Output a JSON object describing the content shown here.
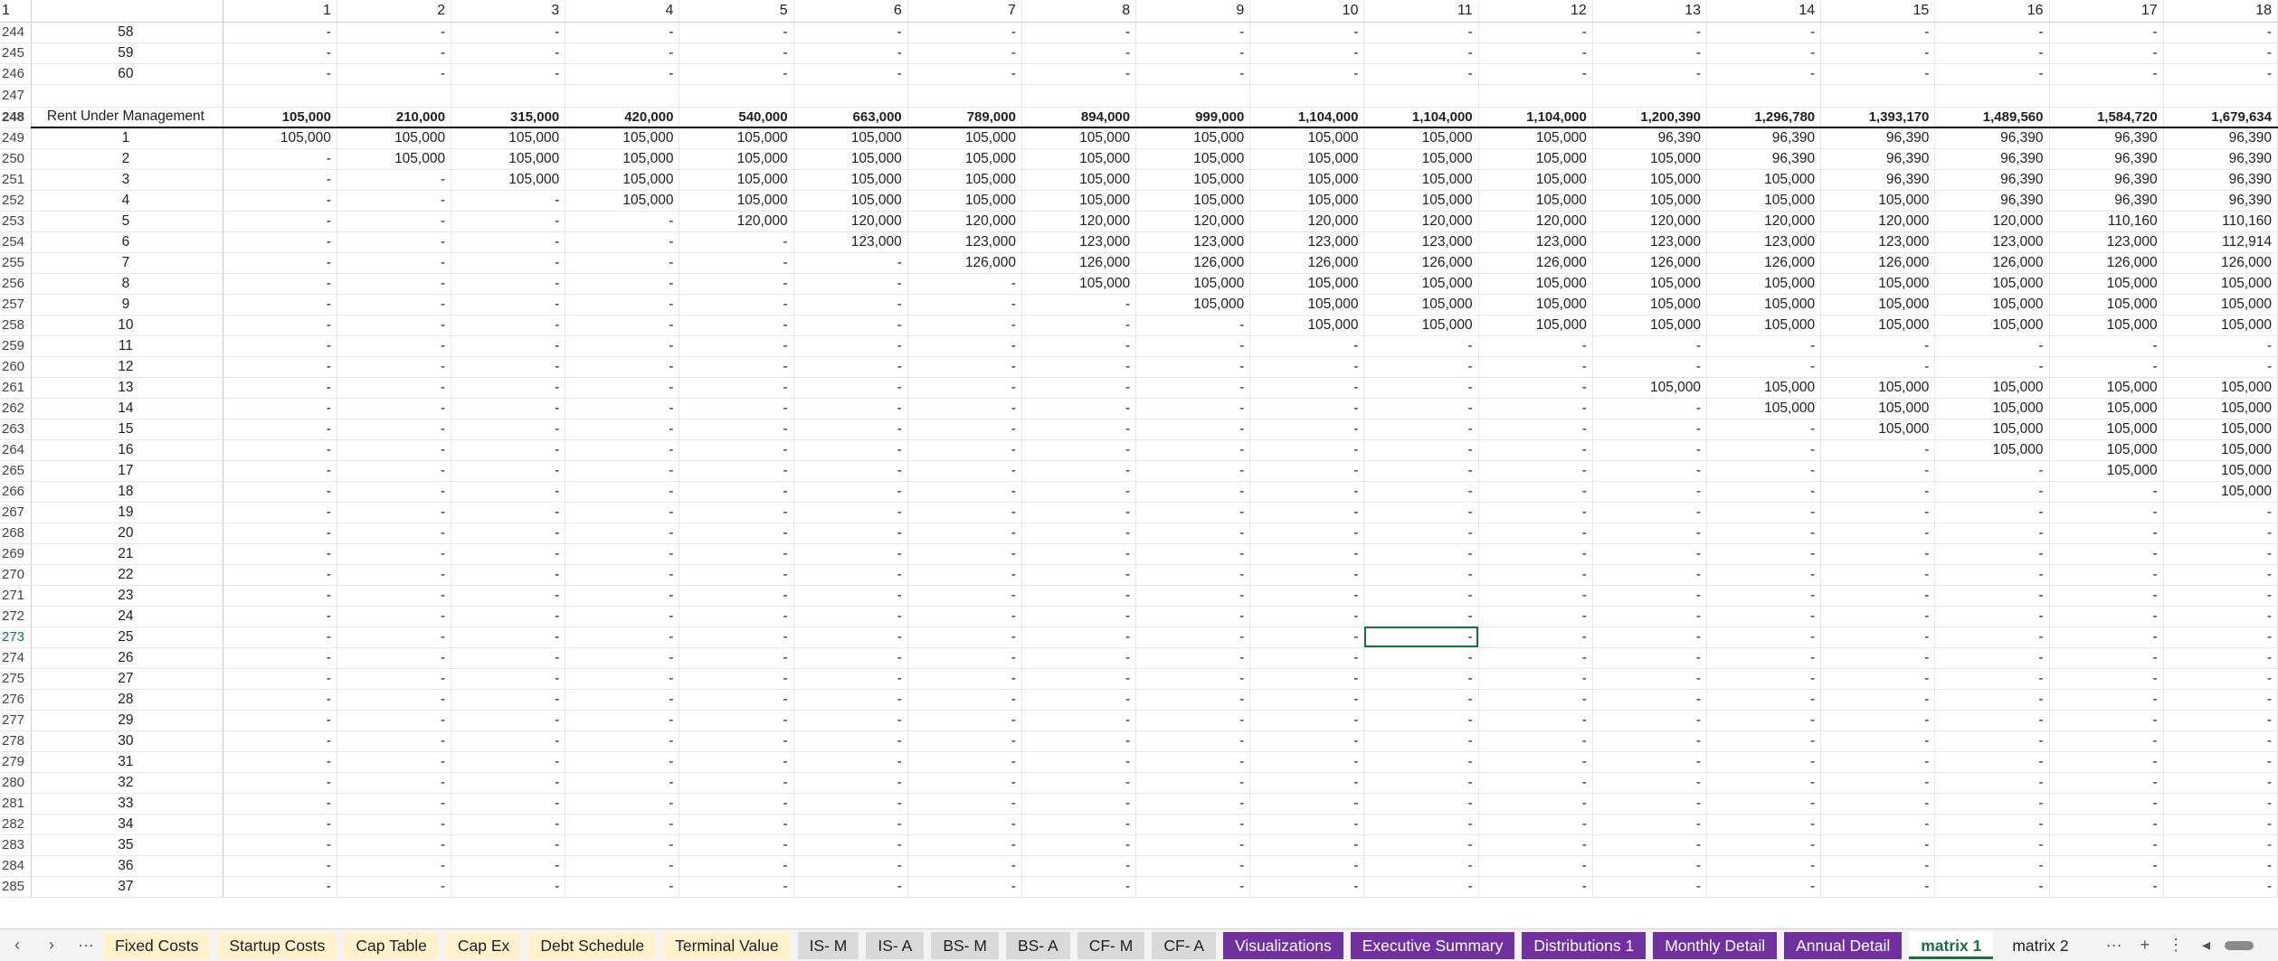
{
  "column_numbers": [
    "1",
    "2",
    "3",
    "4",
    "5",
    "6",
    "7",
    "8",
    "9",
    "10",
    "11",
    "12",
    "13",
    "14",
    "15",
    "16",
    "17",
    "18"
  ],
  "header_row_number": "1",
  "rows": [
    {
      "row": "244",
      "label": "58",
      "values": [
        "-",
        "-",
        "-",
        "-",
        "-",
        "-",
        "-",
        "-",
        "-",
        "-",
        "-",
        "-",
        "-",
        "-",
        "-",
        "-",
        "-",
        "-"
      ]
    },
    {
      "row": "245",
      "label": "59",
      "values": [
        "-",
        "-",
        "-",
        "-",
        "-",
        "-",
        "-",
        "-",
        "-",
        "-",
        "-",
        "-",
        "-",
        "-",
        "-",
        "-",
        "-",
        "-"
      ]
    },
    {
      "row": "246",
      "label": "60",
      "values": [
        "-",
        "-",
        "-",
        "-",
        "-",
        "-",
        "-",
        "-",
        "-",
        "-",
        "-",
        "-",
        "-",
        "-",
        "-",
        "-",
        "-",
        "-"
      ]
    },
    {
      "row": "247",
      "label": "",
      "values": [
        "",
        "",
        "",
        "",
        "",
        "",
        "",
        "",
        "",
        "",
        "",
        "",
        "",
        "",
        "",
        "",
        "",
        ""
      ],
      "gap": true
    },
    {
      "row": "248",
      "label": "Rent Under Management",
      "values": [
        "105,000",
        "210,000",
        "315,000",
        "420,000",
        "540,000",
        "663,000",
        "789,000",
        "894,000",
        "999,000",
        "1,104,000",
        "1,104,000",
        "1,104,000",
        "1,200,390",
        "1,296,780",
        "1,393,170",
        "1,489,560",
        "1,584,720",
        "1,679,634"
      ],
      "summary": true
    },
    {
      "row": "249",
      "label": "1",
      "values": [
        "105,000",
        "105,000",
        "105,000",
        "105,000",
        "105,000",
        "105,000",
        "105,000",
        "105,000",
        "105,000",
        "105,000",
        "105,000",
        "105,000",
        "96,390",
        "96,390",
        "96,390",
        "96,390",
        "96,390",
        "96,390"
      ]
    },
    {
      "row": "250",
      "label": "2",
      "values": [
        "-",
        "105,000",
        "105,000",
        "105,000",
        "105,000",
        "105,000",
        "105,000",
        "105,000",
        "105,000",
        "105,000",
        "105,000",
        "105,000",
        "105,000",
        "96,390",
        "96,390",
        "96,390",
        "96,390",
        "96,390"
      ]
    },
    {
      "row": "251",
      "label": "3",
      "values": [
        "-",
        "-",
        "105,000",
        "105,000",
        "105,000",
        "105,000",
        "105,000",
        "105,000",
        "105,000",
        "105,000",
        "105,000",
        "105,000",
        "105,000",
        "105,000",
        "96,390",
        "96,390",
        "96,390",
        "96,390"
      ]
    },
    {
      "row": "252",
      "label": "4",
      "values": [
        "-",
        "-",
        "-",
        "105,000",
        "105,000",
        "105,000",
        "105,000",
        "105,000",
        "105,000",
        "105,000",
        "105,000",
        "105,000",
        "105,000",
        "105,000",
        "105,000",
        "96,390",
        "96,390",
        "96,390"
      ]
    },
    {
      "row": "253",
      "label": "5",
      "values": [
        "-",
        "-",
        "-",
        "-",
        "120,000",
        "120,000",
        "120,000",
        "120,000",
        "120,000",
        "120,000",
        "120,000",
        "120,000",
        "120,000",
        "120,000",
        "120,000",
        "120,000",
        "110,160",
        "110,160"
      ]
    },
    {
      "row": "254",
      "label": "6",
      "values": [
        "-",
        "-",
        "-",
        "-",
        "-",
        "123,000",
        "123,000",
        "123,000",
        "123,000",
        "123,000",
        "123,000",
        "123,000",
        "123,000",
        "123,000",
        "123,000",
        "123,000",
        "123,000",
        "112,914"
      ]
    },
    {
      "row": "255",
      "label": "7",
      "values": [
        "-",
        "-",
        "-",
        "-",
        "-",
        "-",
        "126,000",
        "126,000",
        "126,000",
        "126,000",
        "126,000",
        "126,000",
        "126,000",
        "126,000",
        "126,000",
        "126,000",
        "126,000",
        "126,000"
      ]
    },
    {
      "row": "256",
      "label": "8",
      "values": [
        "-",
        "-",
        "-",
        "-",
        "-",
        "-",
        "-",
        "105,000",
        "105,000",
        "105,000",
        "105,000",
        "105,000",
        "105,000",
        "105,000",
        "105,000",
        "105,000",
        "105,000",
        "105,000"
      ]
    },
    {
      "row": "257",
      "label": "9",
      "values": [
        "-",
        "-",
        "-",
        "-",
        "-",
        "-",
        "-",
        "-",
        "105,000",
        "105,000",
        "105,000",
        "105,000",
        "105,000",
        "105,000",
        "105,000",
        "105,000",
        "105,000",
        "105,000"
      ]
    },
    {
      "row": "258",
      "label": "10",
      "values": [
        "-",
        "-",
        "-",
        "-",
        "-",
        "-",
        "-",
        "-",
        "-",
        "105,000",
        "105,000",
        "105,000",
        "105,000",
        "105,000",
        "105,000",
        "105,000",
        "105,000",
        "105,000"
      ]
    },
    {
      "row": "259",
      "label": "11",
      "values": [
        "-",
        "-",
        "-",
        "-",
        "-",
        "-",
        "-",
        "-",
        "-",
        "-",
        "-",
        "-",
        "-",
        "-",
        "-",
        "-",
        "-",
        "-"
      ]
    },
    {
      "row": "260",
      "label": "12",
      "values": [
        "-",
        "-",
        "-",
        "-",
        "-",
        "-",
        "-",
        "-",
        "-",
        "-",
        "-",
        "-",
        "-",
        "-",
        "-",
        "-",
        "-",
        "-"
      ]
    },
    {
      "row": "261",
      "label": "13",
      "values": [
        "-",
        "-",
        "-",
        "-",
        "-",
        "-",
        "-",
        "-",
        "-",
        "-",
        "-",
        "-",
        "105,000",
        "105,000",
        "105,000",
        "105,000",
        "105,000",
        "105,000"
      ]
    },
    {
      "row": "262",
      "label": "14",
      "values": [
        "-",
        "-",
        "-",
        "-",
        "-",
        "-",
        "-",
        "-",
        "-",
        "-",
        "-",
        "-",
        "-",
        "105,000",
        "105,000",
        "105,000",
        "105,000",
        "105,000"
      ]
    },
    {
      "row": "263",
      "label": "15",
      "values": [
        "-",
        "-",
        "-",
        "-",
        "-",
        "-",
        "-",
        "-",
        "-",
        "-",
        "-",
        "-",
        "-",
        "-",
        "105,000",
        "105,000",
        "105,000",
        "105,000"
      ]
    },
    {
      "row": "264",
      "label": "16",
      "values": [
        "-",
        "-",
        "-",
        "-",
        "-",
        "-",
        "-",
        "-",
        "-",
        "-",
        "-",
        "-",
        "-",
        "-",
        "-",
        "105,000",
        "105,000",
        "105,000"
      ]
    },
    {
      "row": "265",
      "label": "17",
      "values": [
        "-",
        "-",
        "-",
        "-",
        "-",
        "-",
        "-",
        "-",
        "-",
        "-",
        "-",
        "-",
        "-",
        "-",
        "-",
        "-",
        "105,000",
        "105,000"
      ]
    },
    {
      "row": "266",
      "label": "18",
      "values": [
        "-",
        "-",
        "-",
        "-",
        "-",
        "-",
        "-",
        "-",
        "-",
        "-",
        "-",
        "-",
        "-",
        "-",
        "-",
        "-",
        "-",
        "105,000"
      ]
    },
    {
      "row": "267",
      "label": "19",
      "values": [
        "-",
        "-",
        "-",
        "-",
        "-",
        "-",
        "-",
        "-",
        "-",
        "-",
        "-",
        "-",
        "-",
        "-",
        "-",
        "-",
        "-",
        "-"
      ]
    },
    {
      "row": "268",
      "label": "20",
      "values": [
        "-",
        "-",
        "-",
        "-",
        "-",
        "-",
        "-",
        "-",
        "-",
        "-",
        "-",
        "-",
        "-",
        "-",
        "-",
        "-",
        "-",
        "-"
      ]
    },
    {
      "row": "269",
      "label": "21",
      "values": [
        "-",
        "-",
        "-",
        "-",
        "-",
        "-",
        "-",
        "-",
        "-",
        "-",
        "-",
        "-",
        "-",
        "-",
        "-",
        "-",
        "-",
        "-"
      ]
    },
    {
      "row": "270",
      "label": "22",
      "values": [
        "-",
        "-",
        "-",
        "-",
        "-",
        "-",
        "-",
        "-",
        "-",
        "-",
        "-",
        "-",
        "-",
        "-",
        "-",
        "-",
        "-",
        "-"
      ]
    },
    {
      "row": "271",
      "label": "23",
      "values": [
        "-",
        "-",
        "-",
        "-",
        "-",
        "-",
        "-",
        "-",
        "-",
        "-",
        "-",
        "-",
        "-",
        "-",
        "-",
        "-",
        "-",
        "-"
      ]
    },
    {
      "row": "272",
      "label": "24",
      "values": [
        "-",
        "-",
        "-",
        "-",
        "-",
        "-",
        "-",
        "-",
        "-",
        "-",
        "-",
        "-",
        "-",
        "-",
        "-",
        "-",
        "-",
        "-"
      ]
    },
    {
      "row": "273",
      "label": "25",
      "values": [
        "-",
        "-",
        "-",
        "-",
        "-",
        "-",
        "-",
        "-",
        "-",
        "-",
        "-",
        "-",
        "-",
        "-",
        "-",
        "-",
        "-",
        "-"
      ],
      "active": true,
      "selected_col": 11
    },
    {
      "row": "274",
      "label": "26",
      "values": [
        "-",
        "-",
        "-",
        "-",
        "-",
        "-",
        "-",
        "-",
        "-",
        "-",
        "-",
        "-",
        "-",
        "-",
        "-",
        "-",
        "-",
        "-"
      ]
    },
    {
      "row": "275",
      "label": "27",
      "values": [
        "-",
        "-",
        "-",
        "-",
        "-",
        "-",
        "-",
        "-",
        "-",
        "-",
        "-",
        "-",
        "-",
        "-",
        "-",
        "-",
        "-",
        "-"
      ]
    },
    {
      "row": "276",
      "label": "28",
      "values": [
        "-",
        "-",
        "-",
        "-",
        "-",
        "-",
        "-",
        "-",
        "-",
        "-",
        "-",
        "-",
        "-",
        "-",
        "-",
        "-",
        "-",
        "-"
      ]
    },
    {
      "row": "277",
      "label": "29",
      "values": [
        "-",
        "-",
        "-",
        "-",
        "-",
        "-",
        "-",
        "-",
        "-",
        "-",
        "-",
        "-",
        "-",
        "-",
        "-",
        "-",
        "-",
        "-"
      ]
    },
    {
      "row": "278",
      "label": "30",
      "values": [
        "-",
        "-",
        "-",
        "-",
        "-",
        "-",
        "-",
        "-",
        "-",
        "-",
        "-",
        "-",
        "-",
        "-",
        "-",
        "-",
        "-",
        "-"
      ]
    },
    {
      "row": "279",
      "label": "31",
      "values": [
        "-",
        "-",
        "-",
        "-",
        "-",
        "-",
        "-",
        "-",
        "-",
        "-",
        "-",
        "-",
        "-",
        "-",
        "-",
        "-",
        "-",
        "-"
      ]
    },
    {
      "row": "280",
      "label": "32",
      "values": [
        "-",
        "-",
        "-",
        "-",
        "-",
        "-",
        "-",
        "-",
        "-",
        "-",
        "-",
        "-",
        "-",
        "-",
        "-",
        "-",
        "-",
        "-"
      ]
    },
    {
      "row": "281",
      "label": "33",
      "values": [
        "-",
        "-",
        "-",
        "-",
        "-",
        "-",
        "-",
        "-",
        "-",
        "-",
        "-",
        "-",
        "-",
        "-",
        "-",
        "-",
        "-",
        "-"
      ]
    },
    {
      "row": "282",
      "label": "34",
      "values": [
        "-",
        "-",
        "-",
        "-",
        "-",
        "-",
        "-",
        "-",
        "-",
        "-",
        "-",
        "-",
        "-",
        "-",
        "-",
        "-",
        "-",
        "-"
      ]
    },
    {
      "row": "283",
      "label": "35",
      "values": [
        "-",
        "-",
        "-",
        "-",
        "-",
        "-",
        "-",
        "-",
        "-",
        "-",
        "-",
        "-",
        "-",
        "-",
        "-",
        "-",
        "-",
        "-"
      ]
    },
    {
      "row": "284",
      "label": "36",
      "values": [
        "-",
        "-",
        "-",
        "-",
        "-",
        "-",
        "-",
        "-",
        "-",
        "-",
        "-",
        "-",
        "-",
        "-",
        "-",
        "-",
        "-",
        "-"
      ]
    },
    {
      "row": "285",
      "label": "37",
      "values": [
        "-",
        "-",
        "-",
        "-",
        "-",
        "-",
        "-",
        "-",
        "-",
        "-",
        "-",
        "-",
        "-",
        "-",
        "-",
        "-",
        "-",
        "-"
      ]
    }
  ],
  "sheet_tabs": [
    {
      "label": "Fixed Costs",
      "color": "yellow"
    },
    {
      "label": "Startup Costs",
      "color": "yellow"
    },
    {
      "label": "Cap Table",
      "color": "yellow"
    },
    {
      "label": "Cap Ex",
      "color": "yellow"
    },
    {
      "label": "Debt Schedule",
      "color": "yellow"
    },
    {
      "label": "Terminal Value",
      "color": "yellow"
    },
    {
      "label": "IS- M",
      "color": "gray"
    },
    {
      "label": "IS- A",
      "color": "gray"
    },
    {
      "label": "BS- M",
      "color": "gray"
    },
    {
      "label": "BS- A",
      "color": "gray"
    },
    {
      "label": "CF- M",
      "color": "gray"
    },
    {
      "label": "CF- A",
      "color": "gray"
    },
    {
      "label": "Visualizations",
      "color": "purple"
    },
    {
      "label": "Executive Summary",
      "color": "purple"
    },
    {
      "label": "Distributions 1",
      "color": "purple"
    },
    {
      "label": "Monthly Detail",
      "color": "purple"
    },
    {
      "label": "Annual Detail",
      "color": "purple"
    },
    {
      "label": "matrix 1",
      "color": "active"
    },
    {
      "label": "matrix 2",
      "color": "plain"
    }
  ],
  "tab_nav": {
    "prev": "‹",
    "next": "›",
    "more": "···"
  },
  "tab_end": {
    "more": "···",
    "add": "+",
    "menu": "⋮",
    "scroll_left": "◂"
  },
  "colors": {
    "selection": "#1e6e42",
    "yellow_tab": "#fff2cc",
    "gray_tab": "#d9d9d9",
    "purple_tab": "#7030a0"
  }
}
